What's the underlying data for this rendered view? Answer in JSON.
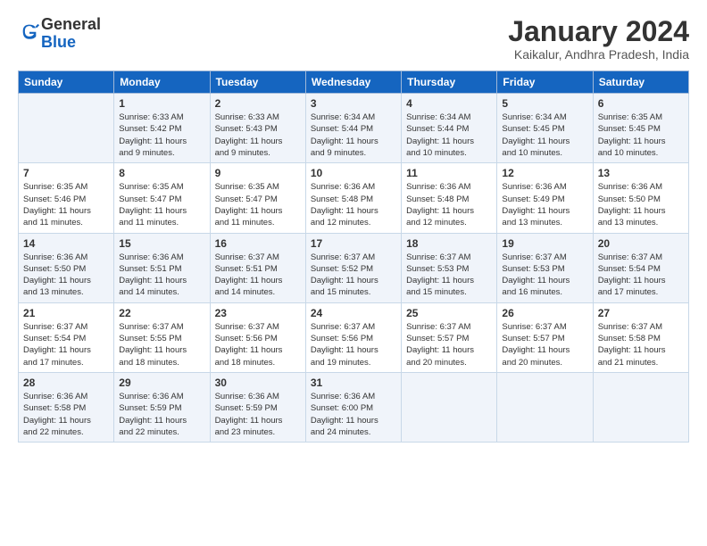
{
  "logo": {
    "general": "General",
    "blue": "Blue"
  },
  "title": "January 2024",
  "location": "Kaikalur, Andhra Pradesh, India",
  "days_header": [
    "Sunday",
    "Monday",
    "Tuesday",
    "Wednesday",
    "Thursday",
    "Friday",
    "Saturday"
  ],
  "weeks": [
    [
      {
        "day": "",
        "info": ""
      },
      {
        "day": "1",
        "info": "Sunrise: 6:33 AM\nSunset: 5:42 PM\nDaylight: 11 hours\nand 9 minutes."
      },
      {
        "day": "2",
        "info": "Sunrise: 6:33 AM\nSunset: 5:43 PM\nDaylight: 11 hours\nand 9 minutes."
      },
      {
        "day": "3",
        "info": "Sunrise: 6:34 AM\nSunset: 5:44 PM\nDaylight: 11 hours\nand 9 minutes."
      },
      {
        "day": "4",
        "info": "Sunrise: 6:34 AM\nSunset: 5:44 PM\nDaylight: 11 hours\nand 10 minutes."
      },
      {
        "day": "5",
        "info": "Sunrise: 6:34 AM\nSunset: 5:45 PM\nDaylight: 11 hours\nand 10 minutes."
      },
      {
        "day": "6",
        "info": "Sunrise: 6:35 AM\nSunset: 5:45 PM\nDaylight: 11 hours\nand 10 minutes."
      }
    ],
    [
      {
        "day": "7",
        "info": "Sunrise: 6:35 AM\nSunset: 5:46 PM\nDaylight: 11 hours\nand 11 minutes."
      },
      {
        "day": "8",
        "info": "Sunrise: 6:35 AM\nSunset: 5:47 PM\nDaylight: 11 hours\nand 11 minutes."
      },
      {
        "day": "9",
        "info": "Sunrise: 6:35 AM\nSunset: 5:47 PM\nDaylight: 11 hours\nand 11 minutes."
      },
      {
        "day": "10",
        "info": "Sunrise: 6:36 AM\nSunset: 5:48 PM\nDaylight: 11 hours\nand 12 minutes."
      },
      {
        "day": "11",
        "info": "Sunrise: 6:36 AM\nSunset: 5:48 PM\nDaylight: 11 hours\nand 12 minutes."
      },
      {
        "day": "12",
        "info": "Sunrise: 6:36 AM\nSunset: 5:49 PM\nDaylight: 11 hours\nand 13 minutes."
      },
      {
        "day": "13",
        "info": "Sunrise: 6:36 AM\nSunset: 5:50 PM\nDaylight: 11 hours\nand 13 minutes."
      }
    ],
    [
      {
        "day": "14",
        "info": "Sunrise: 6:36 AM\nSunset: 5:50 PM\nDaylight: 11 hours\nand 13 minutes."
      },
      {
        "day": "15",
        "info": "Sunrise: 6:36 AM\nSunset: 5:51 PM\nDaylight: 11 hours\nand 14 minutes."
      },
      {
        "day": "16",
        "info": "Sunrise: 6:37 AM\nSunset: 5:51 PM\nDaylight: 11 hours\nand 14 minutes."
      },
      {
        "day": "17",
        "info": "Sunrise: 6:37 AM\nSunset: 5:52 PM\nDaylight: 11 hours\nand 15 minutes."
      },
      {
        "day": "18",
        "info": "Sunrise: 6:37 AM\nSunset: 5:53 PM\nDaylight: 11 hours\nand 15 minutes."
      },
      {
        "day": "19",
        "info": "Sunrise: 6:37 AM\nSunset: 5:53 PM\nDaylight: 11 hours\nand 16 minutes."
      },
      {
        "day": "20",
        "info": "Sunrise: 6:37 AM\nSunset: 5:54 PM\nDaylight: 11 hours\nand 17 minutes."
      }
    ],
    [
      {
        "day": "21",
        "info": "Sunrise: 6:37 AM\nSunset: 5:54 PM\nDaylight: 11 hours\nand 17 minutes."
      },
      {
        "day": "22",
        "info": "Sunrise: 6:37 AM\nSunset: 5:55 PM\nDaylight: 11 hours\nand 18 minutes."
      },
      {
        "day": "23",
        "info": "Sunrise: 6:37 AM\nSunset: 5:56 PM\nDaylight: 11 hours\nand 18 minutes."
      },
      {
        "day": "24",
        "info": "Sunrise: 6:37 AM\nSunset: 5:56 PM\nDaylight: 11 hours\nand 19 minutes."
      },
      {
        "day": "25",
        "info": "Sunrise: 6:37 AM\nSunset: 5:57 PM\nDaylight: 11 hours\nand 20 minutes."
      },
      {
        "day": "26",
        "info": "Sunrise: 6:37 AM\nSunset: 5:57 PM\nDaylight: 11 hours\nand 20 minutes."
      },
      {
        "day": "27",
        "info": "Sunrise: 6:37 AM\nSunset: 5:58 PM\nDaylight: 11 hours\nand 21 minutes."
      }
    ],
    [
      {
        "day": "28",
        "info": "Sunrise: 6:36 AM\nSunset: 5:58 PM\nDaylight: 11 hours\nand 22 minutes."
      },
      {
        "day": "29",
        "info": "Sunrise: 6:36 AM\nSunset: 5:59 PM\nDaylight: 11 hours\nand 22 minutes."
      },
      {
        "day": "30",
        "info": "Sunrise: 6:36 AM\nSunset: 5:59 PM\nDaylight: 11 hours\nand 23 minutes."
      },
      {
        "day": "31",
        "info": "Sunrise: 6:36 AM\nSunset: 6:00 PM\nDaylight: 11 hours\nand 24 minutes."
      },
      {
        "day": "",
        "info": ""
      },
      {
        "day": "",
        "info": ""
      },
      {
        "day": "",
        "info": ""
      }
    ]
  ]
}
